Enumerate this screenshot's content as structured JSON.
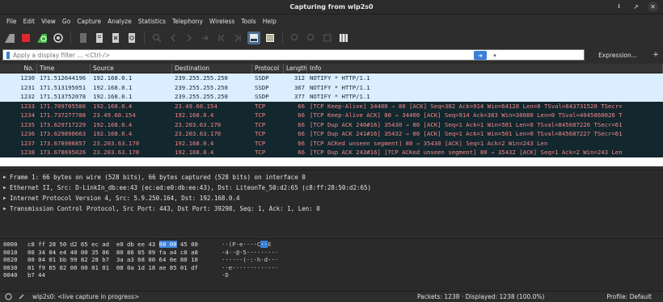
{
  "window": {
    "title": "Capturing from wlp2s0"
  },
  "menu": [
    "File",
    "Edit",
    "View",
    "Go",
    "Capture",
    "Analyze",
    "Statistics",
    "Telephony",
    "Wireless",
    "Tools",
    "Help"
  ],
  "filter": {
    "placeholder": "Apply a display filter ... <Ctrl-/>",
    "expression_label": "Expression...",
    "plus_label": "+"
  },
  "packet_list": {
    "columns": [
      "No.",
      "Time",
      "Source",
      "Destination",
      "Protocol",
      "Length",
      "Info"
    ],
    "rows": [
      {
        "no": "1230",
        "time": "171.512644196",
        "src": "192.168.0.1",
        "dst": "239.255.255.250",
        "proto": "SSDP",
        "len": "312",
        "info": "NOTIFY * HTTP/1.1",
        "kind": "ssdp"
      },
      {
        "no": "1231",
        "time": "171.513195051",
        "src": "192.168.0.1",
        "dst": "239.255.255.250",
        "proto": "SSDP",
        "len": "367",
        "info": "NOTIFY * HTTP/1.1",
        "kind": "ssdp"
      },
      {
        "no": "1232",
        "time": "171.513752078",
        "src": "192.168.0.1",
        "dst": "239.255.255.250",
        "proto": "SSDP",
        "len": "377",
        "info": "NOTIFY * HTTP/1.1",
        "kind": "ssdp"
      },
      {
        "no": "1233",
        "time": "171.709705586",
        "src": "192.168.0.4",
        "dst": "23.49.60.154",
        "proto": "TCP",
        "len": "66",
        "info": "[TCP Keep-Alive] 34400 → 80 [ACK] Seq=382 Ack=914 Win=64128 Len=0 TSval=843731520 TSecr=",
        "kind": "tcp"
      },
      {
        "no": "1234",
        "time": "171.737277788",
        "src": "23.49.60.154",
        "dst": "192.168.0.4",
        "proto": "TCP",
        "len": "66",
        "info": "[TCP Keep-Alive ACK] 80 → 34400 [ACK] Seq=914 Ack=383 Win=30080 Len=0 TSval=4045860026 T",
        "kind": "tcp"
      },
      {
        "no": "1235",
        "time": "173.629717229",
        "src": "192.168.0.4",
        "dst": "23.203.63.170",
        "proto": "TCP",
        "len": "66",
        "info": "[TCP Dup ACK 240#16] 35430 → 80 [ACK] Seq=1 Ack=1 Win=501 Len=0 TSval=845687226 TSecr=61",
        "kind": "tcp"
      },
      {
        "no": "1236",
        "time": "173.629890663",
        "src": "192.168.0.4",
        "dst": "23.203.63.170",
        "proto": "TCP",
        "len": "66",
        "info": "[TCP Dup ACK 241#16] 35432 → 80 [ACK] Seq=1 Ack=1 Win=501 Len=0 TSval=845687227 TSecr=61",
        "kind": "tcp"
      },
      {
        "no": "1237",
        "time": "173.678906857",
        "src": "23.203.63.170",
        "dst": "192.168.0.4",
        "proto": "TCP",
        "len": "66",
        "info": "[TCP ACKed unseen segment] 80 → 35430 [ACK] Seq=1 Ack=2 Win=243 Len",
        "kind": "tcp"
      },
      {
        "no": "1238",
        "time": "173.678695026",
        "src": "23.203.63.170",
        "dst": "192.168.0.4",
        "proto": "TCP",
        "len": "66",
        "info": "[TCP Dup ACK 243#16] [TCP ACKed unseen segment] 80 → 35432 [ACK] Seq=1 Ack=2 Win=243 Len",
        "kind": "tcp"
      }
    ]
  },
  "details": [
    "Frame 1: 66 bytes on wire (528 bits), 66 bytes captured (528 bits) on interface 0",
    "Ethernet II, Src: D-LinkIn_db:ee:43 (ec:ad:e0:db:ee:43), Dst: LiteonTe_50:d2:65 (c8:ff:28:50:d2:65)",
    "Internet Protocol Version 4, Src: 5.9.250.164, Dst: 192.168.0.4",
    "Transmission Control Protocol, Src Port: 443, Dst Port: 39298, Seq: 1, Ack: 1, Len: 0"
  ],
  "bytes": [
    {
      "off": "0000",
      "hex_a": "c8 ff 28 50 d2 65 ec ad  e0 db ee 43 ",
      "hl": "08 00",
      "hex_b": " 45 00",
      "asc_a": "··(P·e····C",
      "asc_hl": "··",
      "asc_b": "E"
    },
    {
      "off": "0010",
      "hex_a": "00 34 04 e4 40 00 35 06  80 86 05 09 fa a4 c0 a8",
      "hl": "",
      "hex_b": "",
      "asc_a": "·4··@·5·········",
      "asc_hl": "",
      "asc_b": ""
    },
    {
      "off": "0020",
      "hex_a": "00 04 01 bb 99 82 28 b7  3a a3 68 00 64 0e 80 10",
      "hl": "",
      "hex_b": "",
      "asc_a": "······(·:·h·d···",
      "asc_hl": "",
      "asc_b": ""
    },
    {
      "off": "0030",
      "hex_a": "01 f9 65 02 00 00 01 01  08 0a 1d 18 ae 85 01 df",
      "hl": "",
      "hex_b": "",
      "asc_a": "··e·············",
      "asc_hl": "",
      "asc_b": ""
    },
    {
      "off": "0040",
      "hex_a": "b7 44",
      "hl": "",
      "hex_b": "",
      "asc_a": "·D",
      "asc_hl": "",
      "asc_b": ""
    }
  ],
  "status": {
    "interface_text": "wlp2s0: <live capture in progress>",
    "packets_text": "Packets: 1238 · Displayed: 1238 (100.0%)",
    "profile_text": "Profile: Default"
  },
  "colors": {
    "ssdp_bg": "#daeeff",
    "tcp_bg": "#12272e",
    "tcp_fg": "#f78787",
    "accent": "#3a80d7"
  }
}
